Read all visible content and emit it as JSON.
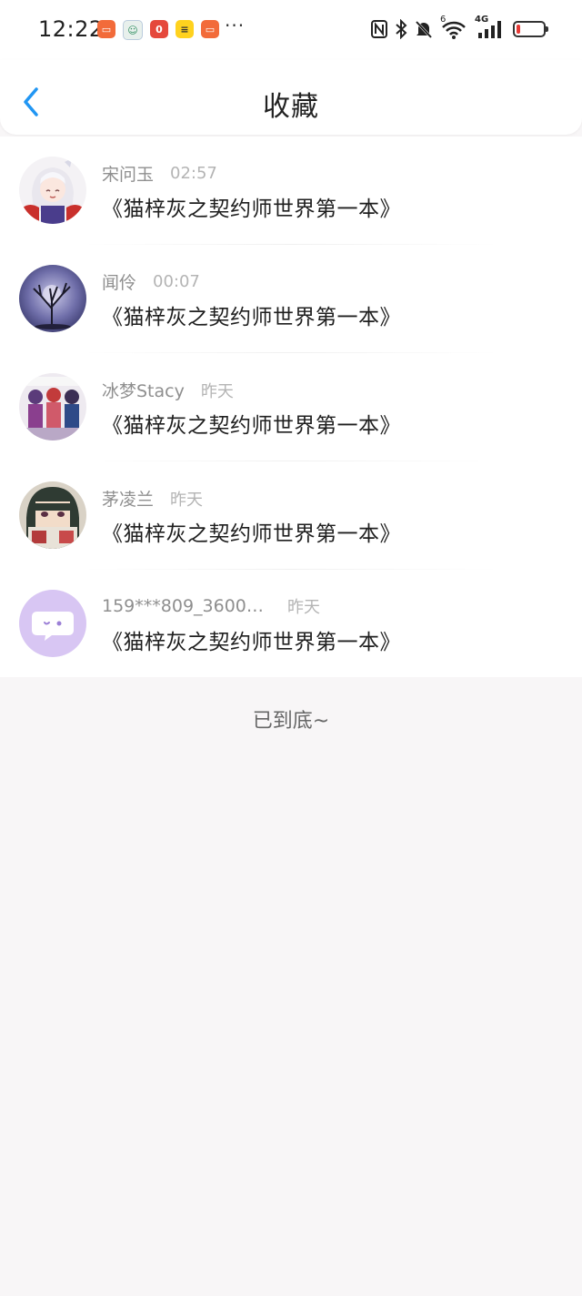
{
  "status_bar": {
    "time": "12:22",
    "more": "···",
    "icons": [
      "app-notification-icon",
      "app-notification-icon",
      "app-notification-icon",
      "app-notification-icon",
      "app-notification-icon",
      "nfc-icon",
      "bluetooth-icon",
      "mute-icon",
      "wifi-icon",
      "4g-signal-icon",
      "battery-icon"
    ],
    "signal_label": "4G",
    "wifi_label": "6"
  },
  "header": {
    "title": "收藏",
    "back_icon": "chevron-left-icon",
    "accent_color": "#2196f3"
  },
  "favorites": [
    {
      "name": "宋问玉",
      "time": "02:57",
      "content": "《猫梓灰之契约师世界第一本》"
    },
    {
      "name": "闻伶",
      "time": "00:07",
      "content": "《猫梓灰之契约师世界第一本》"
    },
    {
      "name": "冰梦Stacy",
      "time": "昨天",
      "content": "《猫梓灰之契约师世界第一本》"
    },
    {
      "name": "茅凌兰",
      "time": "昨天",
      "content": "《猫梓灰之契约师世界第一本》"
    },
    {
      "name": "159***809_36007...",
      "time": "昨天",
      "content": "《猫梓灰之契约师世界第一本》"
    }
  ],
  "footer": {
    "end_text": "已到底~"
  }
}
